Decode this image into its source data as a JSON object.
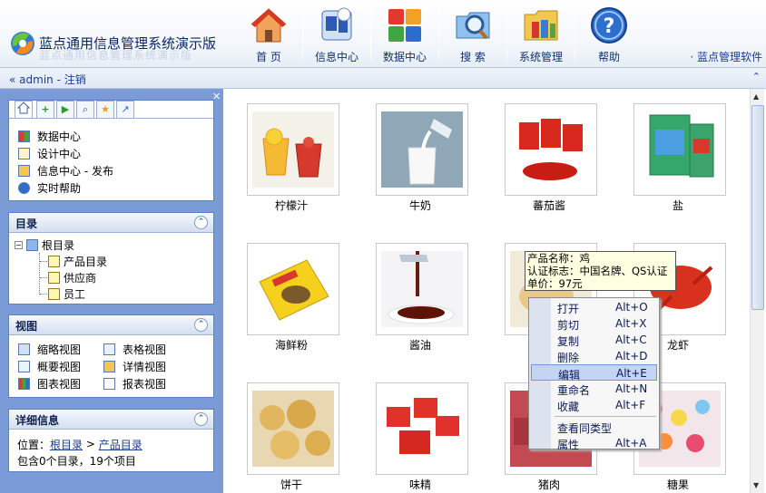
{
  "app": {
    "title": "蓝点通用信息管理系统演示版",
    "title_reflection": "蓝点通用信息管理系统演示版"
  },
  "nav": [
    {
      "label": "首 页",
      "icon": "home-icon"
    },
    {
      "label": "信息中心",
      "icon": "info-center-icon"
    },
    {
      "label": "数据中心",
      "icon": "data-center-icon"
    },
    {
      "label": "搜 索",
      "icon": "search-icon"
    },
    {
      "label": "系统管理",
      "icon": "system-folder-icon"
    },
    {
      "label": "帮助",
      "icon": "help-icon"
    }
  ],
  "header_link": "· 蓝点管理软件",
  "userbar": {
    "prefix": "«",
    "user": "admin",
    "sep": "-",
    "logout": "注销",
    "collapse": "⌃"
  },
  "quick": {
    "tabs": [
      "home-icon",
      "add-icon",
      "go-icon",
      "search-icon",
      "favorite-icon",
      "link-icon"
    ],
    "items": [
      {
        "label": "数据中心",
        "icon": "grid-icon"
      },
      {
        "label": "设计中心",
        "icon": "pencil-icon"
      },
      {
        "label": "信息中心 - 发布",
        "icon": "document-icon"
      },
      {
        "label": "实时帮助",
        "icon": "help-small-icon"
      }
    ]
  },
  "catalog": {
    "title": "目录",
    "root": "根目录",
    "children": [
      "产品目录",
      "供应商",
      "员工"
    ]
  },
  "views": {
    "title": "视图",
    "items": [
      "缩略视图",
      "表格视图",
      "概要视图",
      "详情视图",
      "图表视图",
      "报表视图"
    ]
  },
  "detail": {
    "title": "详细信息",
    "location_label": "位置：",
    "path_root": "根目录",
    "path_sep": ">",
    "path_current": "产品目录",
    "summary": "包含0个目录，19个项目"
  },
  "products": [
    {
      "name": "柠檬汁",
      "image": "lemon-juice"
    },
    {
      "name": "牛奶",
      "image": "milk"
    },
    {
      "name": "蕃茄酱",
      "image": "tomato-sauce"
    },
    {
      "name": "盐",
      "image": "salt"
    },
    {
      "name": "海鲜粉",
      "image": "seafood-powder"
    },
    {
      "name": "酱油",
      "image": "soy-sauce"
    },
    {
      "name": "",
      "image": "chicken"
    },
    {
      "name": "龙虾",
      "image": "lobster"
    },
    {
      "name": "饼干",
      "image": "biscuit"
    },
    {
      "name": "味精",
      "image": "msg"
    },
    {
      "name": "猪肉",
      "image": "pork"
    },
    {
      "name": "糖果",
      "image": "candy"
    }
  ],
  "tooltip": [
    "产品名称：鸡",
    "认证标志：中国名牌、QS认证",
    "单价：97元"
  ],
  "context_menu": [
    {
      "label": "打开",
      "key": "Alt+O"
    },
    {
      "label": "剪切",
      "key": "Alt+X"
    },
    {
      "label": "复制",
      "key": "Alt+C"
    },
    {
      "label": "删除",
      "key": "Alt+D"
    },
    {
      "label": "编辑",
      "key": "Alt+E",
      "selected": true
    },
    {
      "label": "重命名",
      "key": "Alt+N"
    },
    {
      "label": "收藏",
      "key": "Alt+F"
    },
    {
      "label": "查看同类型",
      "key": ""
    },
    {
      "label": "属性",
      "key": "Alt+A"
    }
  ],
  "colors": {
    "panel": "#7b9bd8",
    "accent": "#1c3c8a",
    "menu_highlight": "#c4d5f3"
  }
}
